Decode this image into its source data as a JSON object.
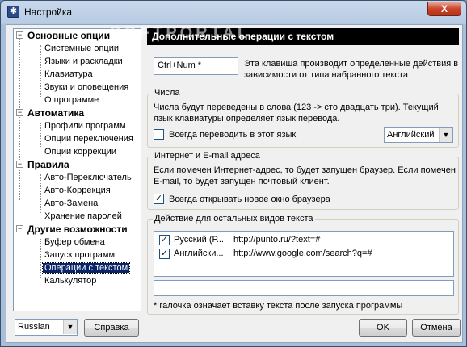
{
  "window": {
    "title": "Настройка",
    "close_label": "X"
  },
  "watermark": "SOFTPORTAL",
  "tree": {
    "groups": [
      {
        "label": "Основные опции",
        "items": [
          "Системные опции",
          "Языки и раскладки",
          "Клавиатура",
          "Звуки и оповещения",
          "О программе"
        ]
      },
      {
        "label": "Автоматика",
        "items": [
          "Профили программ",
          "Опции переключения",
          "Опции коррекции"
        ]
      },
      {
        "label": "Правила",
        "items": [
          "Авто-Переключатель",
          "Авто-Коррекция",
          "Авто-Замена",
          "Хранение паролей"
        ]
      },
      {
        "label": "Другие возможности",
        "items": [
          "Буфер обмена",
          "Запуск программ",
          "Операции с текстом",
          "Калькулятор"
        ]
      }
    ],
    "selected": "Операции с текстом"
  },
  "header": "Дополнительные операции с текстом",
  "hotkey": {
    "value": "Ctrl+Num *",
    "desc": "Эта клавиша производит определенные действия в зависимости от типа набранного текста"
  },
  "numbers": {
    "title": "Числа",
    "text": "Числа будут переведены в слова (123 -> сто двадцать три). Текущий язык клавиатуры определяет язык перевода.",
    "checkbox_label": "Всегда переводить в этот язык",
    "checkbox_checked": false,
    "language": "Английский"
  },
  "internet": {
    "title": "Интернет и E-mail адреса",
    "text": "Если помечен Интернет-адрес, то будет запущен браузер. Если помечен E-mail, то будет запущен почтовый клиент.",
    "checkbox_label": "Всегда открывать новое окно браузера",
    "checkbox_checked": true
  },
  "other": {
    "title": "Действие для остальных видов текста",
    "rows": [
      {
        "name": "Русский (Р...",
        "url": "http://punto.ru/?text=#",
        "checked": true
      },
      {
        "name": "Английски...",
        "url": "http://www.google.com/search?q=#",
        "checked": true
      }
    ],
    "note": "* галочка означает вставку текста после запуска программы"
  },
  "footer": {
    "language": "Russian",
    "help": "Справка",
    "ok": "OK",
    "cancel": "Отмена"
  }
}
